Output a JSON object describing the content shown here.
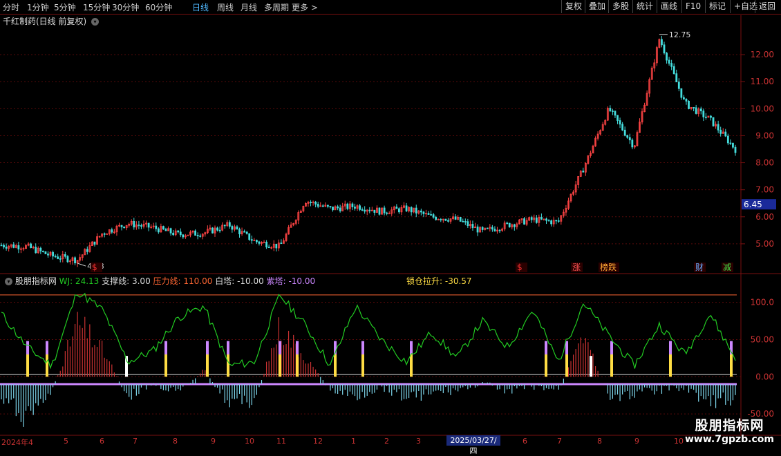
{
  "toolbar": {
    "timeframes": [
      "分时",
      "1分钟",
      "5分钟",
      "15分钟",
      "30分钟",
      "60分钟",
      "日线",
      "周线",
      "月线",
      "多周期",
      "更多 >"
    ],
    "active_index": 6,
    "right_buttons": [
      "复权",
      "叠加",
      "多股",
      "统计",
      "画线",
      "F10",
      "标记",
      "+自选",
      "返回"
    ]
  },
  "stock_title": "千红制药(日线 前复权)",
  "price_panel": {
    "y_ticks": [
      "12.00",
      "11.00",
      "10.00",
      "9.00",
      "8.00",
      "7.00",
      "6.00",
      "5.00"
    ],
    "current_price": "6.45",
    "high_label": "12.75",
    "low_label": "4.28",
    "event_markers": [
      {
        "text": "$",
        "color": "#ff3333"
      },
      {
        "text": "$",
        "color": "#ff3333"
      },
      {
        "text": "涨",
        "color": "#ff5555"
      },
      {
        "text": "榜跌",
        "color": "#ffaa33"
      },
      {
        "text": "财",
        "color": "#66aaff"
      },
      {
        "text": "减",
        "color": "#44dd44"
      }
    ]
  },
  "indicator": {
    "name": "股朋指标网",
    "wj": "WJ: 24.13",
    "support": "支撑线: 3.00",
    "pressure": "压力线: 110.00",
    "white_tower": "白塔: -10.00",
    "purple_tower": "紫塔: -10.00",
    "lock": "锁仓拉升: -30.57",
    "y_ticks": [
      "100.0",
      "50.00",
      "0.00",
      "-50.00"
    ],
    "colors": {
      "wj": "#22cc22",
      "support": "#dddddd",
      "pressure": "#ff6633",
      "white": "#ffffff",
      "purple": "#cc88ff",
      "lock": "#ffdd44"
    }
  },
  "date_axis": {
    "labels": [
      "2024年4",
      "5",
      "6",
      "7",
      "8",
      "9",
      "10",
      "11",
      "12",
      "1",
      "2",
      "3",
      "6",
      "7",
      "8",
      "9",
      "10"
    ],
    "cursor_date": "2025/03/27/四"
  },
  "watermark": {
    "line1": "股朋指标网",
    "line2": "www.7gpzb.com"
  },
  "chart_data": [
    {
      "type": "line",
      "title": "千红制药(日线 前复权)",
      "ylim": [
        4.0,
        13.0
      ],
      "x": [
        0,
        10,
        20,
        30,
        40,
        50,
        60,
        70,
        80,
        90,
        100,
        110,
        120,
        130,
        140,
        150,
        160,
        170,
        180,
        190,
        200,
        210,
        220,
        230,
        240,
        250,
        260,
        270,
        280,
        290
      ],
      "series": [
        {
          "name": "价格",
          "values": [
            4.95,
            4.9,
            4.55,
            4.4,
            5.4,
            5.75,
            5.6,
            5.35,
            5.4,
            5.7,
            5.1,
            4.9,
            6.6,
            6.3,
            6.4,
            6.2,
            6.3,
            6.0,
            5.9,
            5.45,
            5.7,
            5.9,
            5.8,
            7.8,
            10.0,
            8.6,
            12.6,
            10.2,
            9.6,
            8.5
          ]
        }
      ]
    },
    {
      "type": "bar",
      "title": "股朋指标网",
      "ylim": [
        -75,
        135
      ],
      "x": [
        0,
        10,
        20,
        30,
        40,
        50,
        60,
        70,
        80,
        90,
        100,
        110,
        120,
        130,
        140,
        150,
        160,
        170,
        180,
        190,
        200,
        210,
        220,
        230,
        240,
        250,
        260,
        270,
        280,
        290
      ],
      "series": [
        {
          "name": "WJ",
          "values": [
            85,
            40,
            15,
            115,
            90,
            20,
            35,
            80,
            95,
            15,
            20,
            110,
            70,
            15,
            95,
            50,
            20,
            60,
            25,
            75,
            40,
            90,
            20,
            100,
            55,
            15,
            70,
            30,
            85,
            24.13
          ]
        },
        {
          "name": "柱",
          "values": [
            -35,
            -60,
            -20,
            80,
            40,
            -30,
            -10,
            -25,
            10,
            -40,
            -35,
            75,
            30,
            -20,
            -30,
            -15,
            -30,
            -25,
            -20,
            -10,
            -20,
            -15,
            -20,
            60,
            -30,
            -25,
            -20,
            -15,
            -40,
            -30.57
          ]
        }
      ]
    }
  ]
}
